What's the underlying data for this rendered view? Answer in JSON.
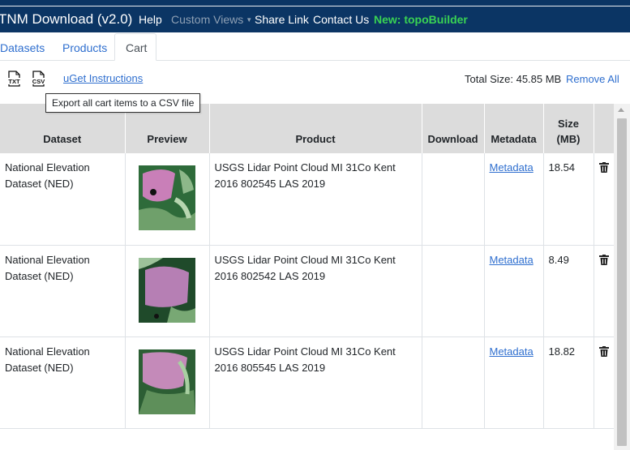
{
  "navbar": {
    "brand": "TNM Download (v2.0)",
    "links": {
      "help": "Help",
      "custom_views": "Custom Views",
      "share_link": "Share Link",
      "contact_us": "Contact Us",
      "new_topobuilder": "New: topoBuilder"
    },
    "colors": {
      "background": "#0b3564",
      "new_accent": "#39d353"
    }
  },
  "tabs": [
    {
      "label": "Datasets",
      "active": false
    },
    {
      "label": "Products",
      "active": false
    },
    {
      "label": "Cart",
      "active": true
    }
  ],
  "toolbar": {
    "txt_icon": "TXT",
    "csv_icon": "CSV",
    "uget_link": "uGet Instructions",
    "total_size": "Total Size: 45.85 MB",
    "remove_all": "Remove All",
    "tooltip": "Export all cart items to a CSV file"
  },
  "table": {
    "headers": {
      "dataset": "Dataset",
      "preview": "Preview",
      "product": "Product",
      "download": "Download",
      "metadata": "Metadata",
      "size": "Size (MB)"
    },
    "rows": [
      {
        "dataset": "National Elevation Dataset (NED)",
        "product": "USGS Lidar Point Cloud MI 31Co Kent 2016 802545 LAS 2019",
        "download": "",
        "metadata": "Metadata",
        "size": "18.54",
        "preview_icon": "lidar-thumbnail"
      },
      {
        "dataset": "National Elevation Dataset (NED)",
        "product": "USGS Lidar Point Cloud MI 31Co Kent 2016 802542 LAS 2019",
        "download": "",
        "metadata": "Metadata",
        "size": "8.49",
        "preview_icon": "lidar-thumbnail"
      },
      {
        "dataset": "National Elevation Dataset (NED)",
        "product": "USGS Lidar Point Cloud MI 31Co Kent 2016 805545 LAS 2019",
        "download": "",
        "metadata": "Metadata",
        "size": "18.82",
        "preview_icon": "lidar-thumbnail"
      }
    ]
  }
}
